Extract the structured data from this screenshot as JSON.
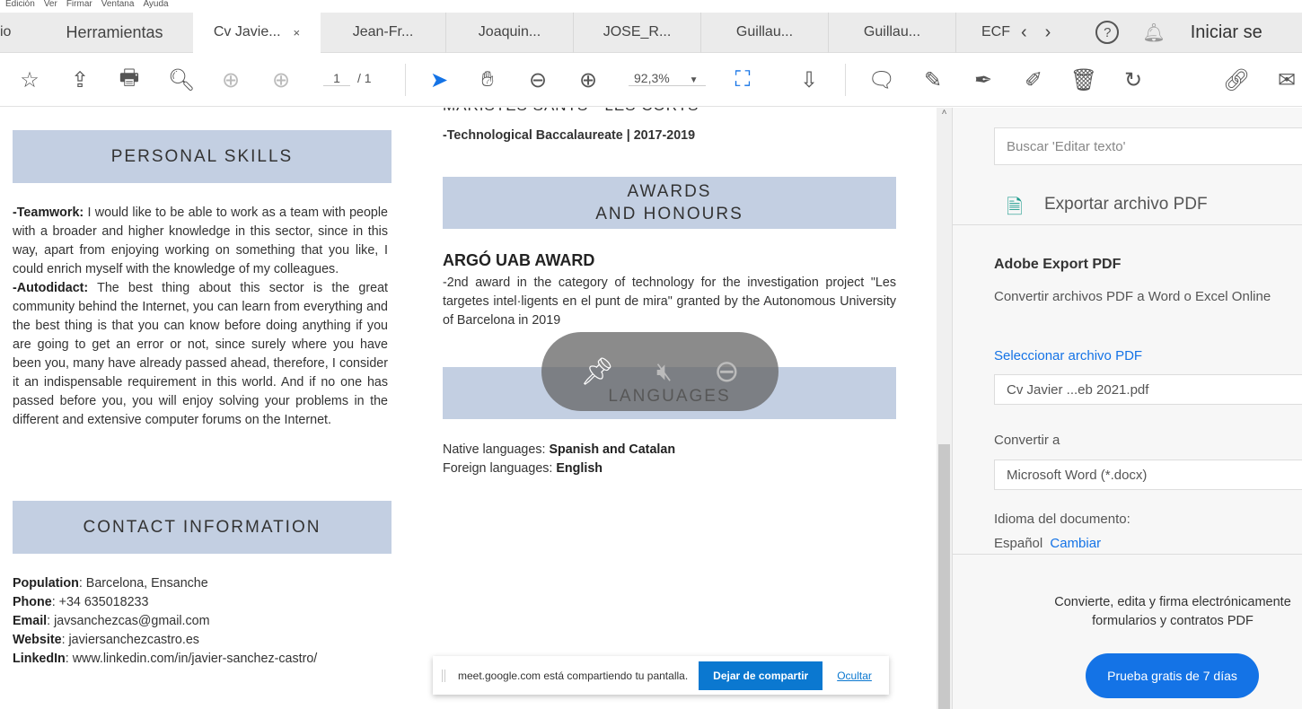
{
  "menu": [
    "Edición",
    "Ver",
    "Firmar",
    "Ventana",
    "Ayuda"
  ],
  "tabs": {
    "home": "io",
    "tools": "Herramientas",
    "docs": [
      "Cv Javie...",
      "Jean-Fr...",
      "Joaquin...",
      "JOSE_R...",
      "Guillau...",
      "Guillau...",
      "ECF"
    ],
    "close": "×",
    "signin": "Iniciar se"
  },
  "toolbar": {
    "page_current": "1",
    "page_total": "/ 1",
    "zoom": "92,3%"
  },
  "doc": {
    "personal_skills": "PERSONAL SKILLS",
    "teamwork_label": "-Teamwork:",
    "teamwork_text": " I would like to be able to work as a team with people with a broader and higher knowledge in this sector, since in this way, apart from enjoying working on something that you like, I could enrich myself with the knowledge of my colleagues.",
    "autodidact_label": "-Autodidact:",
    "autodidact_text": " The best thing about this sector is the great community behind the Internet, you can learn from everything and the best thing is that you can know before doing anything if you are going to get an error or not, since surely where you have been you, many have already passed ahead, therefore, I consider it an indispensable requirement in this world. And if no one has passed before you, you will enjoy solving your problems in the different and extensive computer forums on the Internet.",
    "contact": "CONTACT INFORMATION",
    "contacts": [
      {
        "label": "Population",
        "value": ": Barcelona, Ensanche"
      },
      {
        "label": "Phone",
        "value": ": +34 635018233"
      },
      {
        "label": "Email",
        "value": ": javsanchezcas@gmail.com"
      },
      {
        "label": "Website",
        "value": ": javiersanchezcastro.es"
      },
      {
        "label": "LinkedIn",
        "value": ": www.linkedin.com/in/javier-sanchez-castro/"
      }
    ],
    "school": "MARISTES SANTS - LES CORTS",
    "bacc": "-Technological Baccalaureate | 2017-2019",
    "awards1": "AWARDS",
    "awards2": "AND HONOURS",
    "award_title": "ARGÓ UAB AWARD",
    "award_text": "-2nd award in the category of technology for the investigation project \"Les targetes intel·ligents en el punt de mira\" granted by the Autonomous University of Barcelona in 2019",
    "languages": "LANGUAGES",
    "native_label": "Native languages: ",
    "native": "Spanish and Catalan",
    "foreign_label": "Foreign languages: ",
    "foreign": "English"
  },
  "panel": {
    "search_placeholder": "Buscar 'Editar texto'",
    "export_title": "Exportar archivo PDF",
    "service": "Adobe Export PDF",
    "service_desc": "Convertir archivos PDF a Word o Excel Online",
    "select_link": "Seleccionar archivo PDF",
    "file": "Cv Javier ...eb 2021.pdf",
    "convert_label": "Convertir a",
    "format": "Microsoft Word (*.docx)",
    "lang_label": "Idioma del documento:",
    "lang": "Español",
    "change": "Cambiar",
    "promo": "Convierte, edita y firma electrónicamente formularios y contratos PDF",
    "trial": "Prueba gratis de 7 días"
  },
  "share": {
    "message": "meet.google.com está compartiendo tu pantalla.",
    "stop": "Dejar de compartir",
    "hide": "Ocultar"
  },
  "colors": {
    "accent": "#1473e6",
    "band": "#c3cfe2",
    "share_button": "#0b78d0"
  }
}
